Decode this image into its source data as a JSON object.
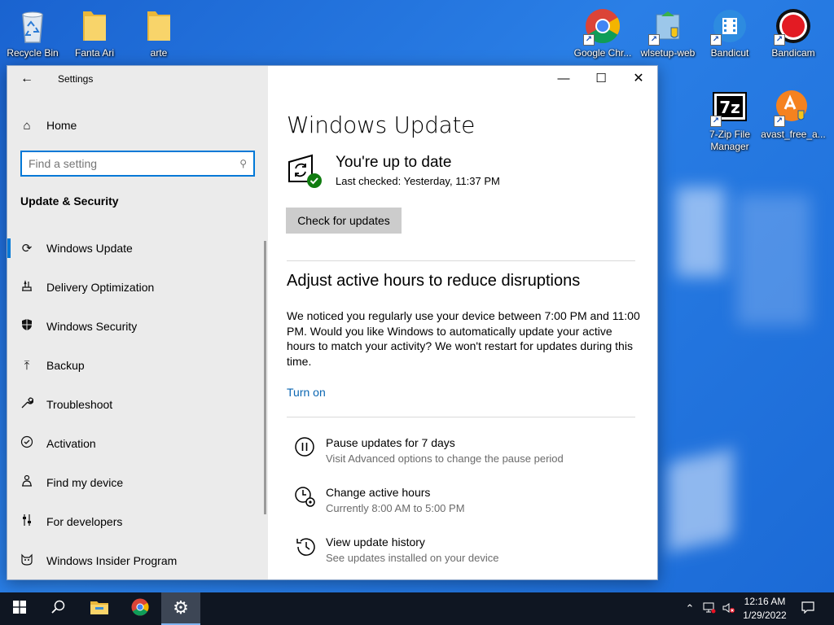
{
  "desktop": {
    "icons": [
      {
        "id": "recycle-bin",
        "label": "Recycle Bin"
      },
      {
        "id": "fanta-ari",
        "label": "Fanta Ari"
      },
      {
        "id": "arte",
        "label": "arte"
      },
      {
        "id": "google-chrome",
        "label": "Google Chr..."
      },
      {
        "id": "wlsetup-web",
        "label": "wlsetup-web"
      },
      {
        "id": "bandicut",
        "label": "Bandicut"
      },
      {
        "id": "bandicam",
        "label": "Bandicam"
      },
      {
        "id": "7zip",
        "label": "7-Zip File Manager"
      },
      {
        "id": "avast",
        "label": "avast_free_a..."
      }
    ]
  },
  "window": {
    "title": "Settings",
    "controls": {
      "minimize": "—",
      "maximize": "☐",
      "close": "✕"
    }
  },
  "sidebar": {
    "home_label": "Home",
    "search_placeholder": "Find a setting",
    "section_title": "Update & Security",
    "items": [
      {
        "label": "Windows Update",
        "icon": "sync-icon",
        "active": true
      },
      {
        "label": "Delivery Optimization",
        "icon": "delivery-icon"
      },
      {
        "label": "Windows Security",
        "icon": "shield-icon"
      },
      {
        "label": "Backup",
        "icon": "backup-arrow-icon"
      },
      {
        "label": "Troubleshoot",
        "icon": "wrench-icon"
      },
      {
        "label": "Activation",
        "icon": "check-circle-icon"
      },
      {
        "label": "Find my device",
        "icon": "person-location-icon"
      },
      {
        "label": "For developers",
        "icon": "sliders-icon"
      },
      {
        "label": "Windows Insider Program",
        "icon": "insider-cat-icon"
      }
    ]
  },
  "main": {
    "title": "Windows Update",
    "status_title": "You're up to date",
    "status_subtitle": "Last checked: Yesterday, 11:37 PM",
    "check_button": "Check for updates",
    "active_hours_title": "Adjust active hours to reduce disruptions",
    "active_hours_text": "We noticed you regularly use your device between 7:00 PM and 11:00 PM. Would you like Windows to automatically update your active hours to match your activity? We won't restart for updates during this time.",
    "turn_on_link": "Turn on",
    "options": [
      {
        "title": "Pause updates for 7 days",
        "subtitle": "Visit Advanced options to change the pause period",
        "icon": "pause-icon"
      },
      {
        "title": "Change active hours",
        "subtitle": "Currently 8:00 AM to 5:00 PM",
        "icon": "clock-settings-icon"
      },
      {
        "title": "View update history",
        "subtitle": "See updates installed on your device",
        "icon": "history-icon"
      }
    ]
  },
  "taskbar": {
    "time": "12:16 AM",
    "date": "1/29/2022"
  },
  "colors": {
    "accent": "#0078d7",
    "link": "#0a66b2",
    "sidebar_bg": "#ebebeb",
    "taskbar_bg": "#0f1622",
    "success_green": "#107c10"
  }
}
